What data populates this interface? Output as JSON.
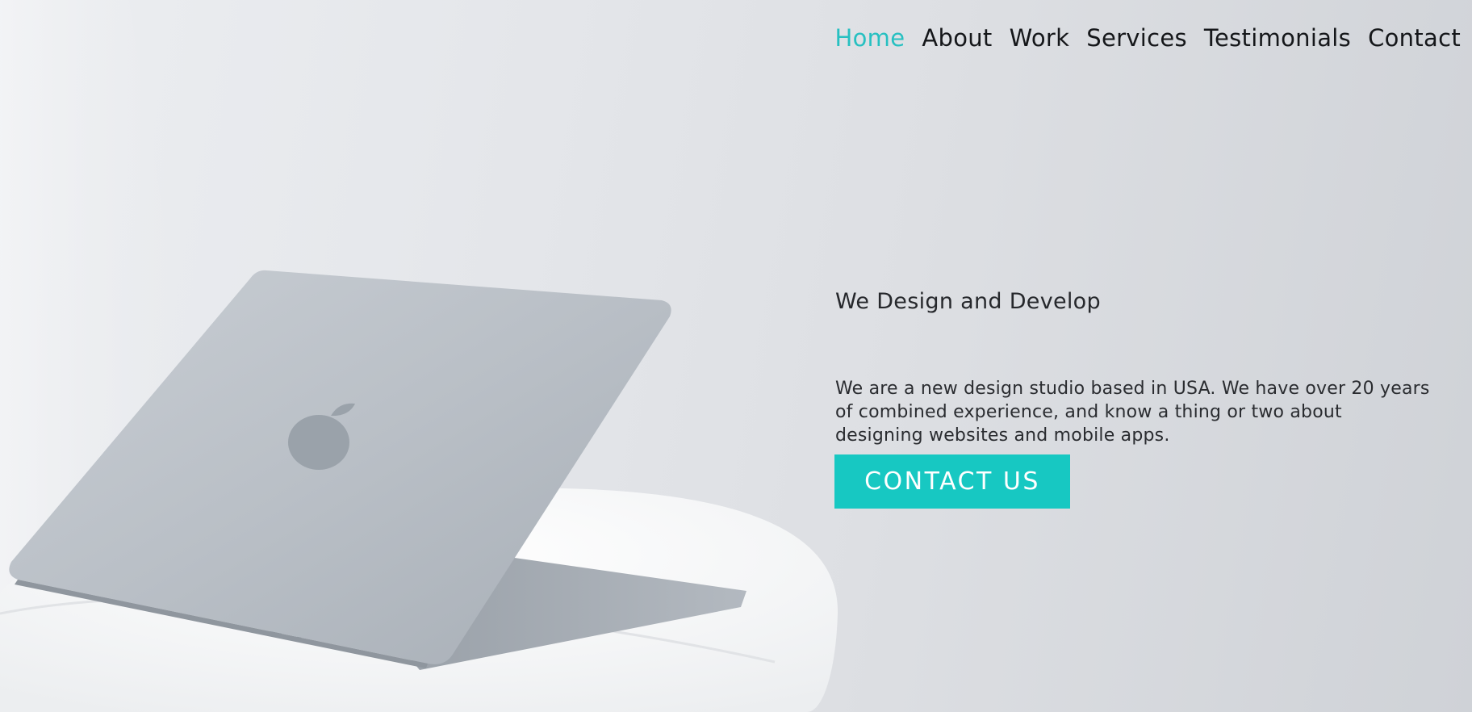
{
  "nav": {
    "items": [
      {
        "label": "Home",
        "active": true
      },
      {
        "label": "About",
        "active": false
      },
      {
        "label": "Work",
        "active": false
      },
      {
        "label": "Services",
        "active": false
      },
      {
        "label": "Testimonials",
        "active": false
      },
      {
        "label": "Contact",
        "active": false
      }
    ]
  },
  "hero": {
    "headline": "We Design and Develop",
    "description": "We are a new design studio based in USA. We have over 20 years of combined experience, and know a thing or two about designing websites and mobile apps.",
    "cta_label": "CONTACT US"
  },
  "colors": {
    "accent": "#17c8c2",
    "active_nav": "#27c0c1",
    "text": "#1e2023"
  }
}
